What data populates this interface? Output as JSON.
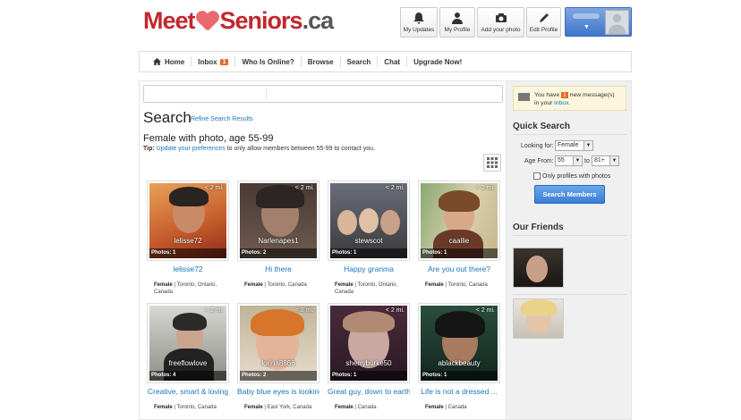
{
  "logo": {
    "part1": "Meet",
    "part2": "Seniors",
    "part3": ".ca"
  },
  "topbar": {
    "buttons": [
      {
        "label": "My Updates",
        "icon": "bell-icon"
      },
      {
        "label": "My Profile",
        "icon": "person-icon"
      },
      {
        "label": "Add your photo",
        "icon": "camera-icon"
      },
      {
        "label": "Edit Profile",
        "icon": "pencil-icon"
      }
    ]
  },
  "nav": {
    "items": [
      "Home",
      "Inbox",
      "Who Is Online?",
      "Browse",
      "Search",
      "Chat",
      "Upgrade Now!"
    ],
    "inbox_count": "1"
  },
  "search": {
    "title": "Search",
    "refine_link": "Refine Search Results",
    "subheading": "Female with photo, age 55-99",
    "tip_label": "Tip:",
    "tip_link": "Update your preferences",
    "tip_text": "to only allow members between 55-99 to contact you."
  },
  "results": [
    {
      "username": "lelisse72",
      "headline": "lelisse72",
      "distance": "< 2 mi.",
      "photos": "Photos: 1",
      "gender": "Female",
      "location": "Toronto, Ontario, Canada"
    },
    {
      "username": "Narlenapes1",
      "headline": "Hi there",
      "distance": "< 2 mi.",
      "photos": "Photos: 2",
      "gender": "Female",
      "location": "Toronto, Canada"
    },
    {
      "username": "stewscot",
      "headline": "Happy granma",
      "distance": "< 2 mi.",
      "photos": "Photos: 1",
      "gender": "Female",
      "location": "Toronto, Ontario, Canada"
    },
    {
      "username": "caallie",
      "headline": "Are you out there?",
      "distance": "< 2 mi.",
      "photos": "Photos: 1",
      "gender": "Female",
      "location": "Toronto, Canada"
    },
    {
      "username": "freeflowlove",
      "headline": "Creative, smart & loving",
      "distance": "< 2 mi.",
      "photos": "Photos: 4",
      "gender": "Female",
      "location": "Toronto, Canada"
    },
    {
      "username": "lorina8866",
      "headline": "Baby blue eyes is looking",
      "distance": "< 2 mi.",
      "photos": "Photos: 2",
      "gender": "Female",
      "location": "East York, Canada"
    },
    {
      "username": "sherryburke50",
      "headline": "Great guy, down to earth...",
      "distance": "< 2 mi.",
      "photos": "Photos: 1",
      "gender": "Female",
      "location": "Canada"
    },
    {
      "username": "ablackbeauty",
      "headline": "Life is not a dressed ...",
      "distance": "< 2 mi.",
      "photos": "Photos: 1",
      "gender": "Female",
      "location": "Canada"
    }
  ],
  "messages": {
    "before": "You have",
    "count": "1",
    "after": "new message(s)",
    "line2": "in your",
    "link": "inbox."
  },
  "quick_search": {
    "title": "Quick Search",
    "looking_for_label": "Looking for:",
    "looking_for_value": "Female",
    "age_from_label": "Age From:",
    "age_from_value": "55",
    "to_label": "to",
    "age_to_value": "81+",
    "only_photos_label": "Only profiles with photos",
    "button_label": "Search Members"
  },
  "friends": {
    "title": "Our Friends"
  },
  "colors": {
    "brand_red": "#c0282d",
    "link_blue": "#1a75bb",
    "badge_orange": "#e26b26",
    "button_blue": "#3a7dd6"
  }
}
